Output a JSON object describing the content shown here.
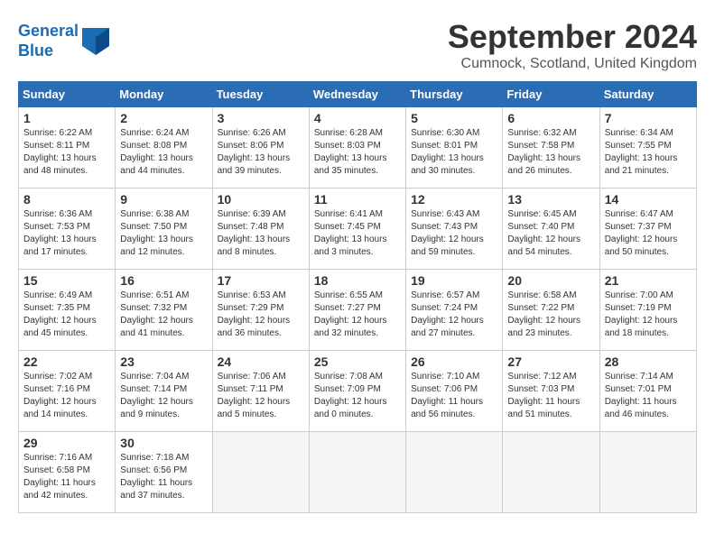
{
  "header": {
    "logo_line1": "General",
    "logo_line2": "Blue",
    "month": "September 2024",
    "location": "Cumnock, Scotland, United Kingdom"
  },
  "weekdays": [
    "Sunday",
    "Monday",
    "Tuesday",
    "Wednesday",
    "Thursday",
    "Friday",
    "Saturday"
  ],
  "weeks": [
    [
      {
        "day": 1,
        "info": "Sunrise: 6:22 AM\nSunset: 8:11 PM\nDaylight: 13 hours\nand 48 minutes."
      },
      {
        "day": 2,
        "info": "Sunrise: 6:24 AM\nSunset: 8:08 PM\nDaylight: 13 hours\nand 44 minutes."
      },
      {
        "day": 3,
        "info": "Sunrise: 6:26 AM\nSunset: 8:06 PM\nDaylight: 13 hours\nand 39 minutes."
      },
      {
        "day": 4,
        "info": "Sunrise: 6:28 AM\nSunset: 8:03 PM\nDaylight: 13 hours\nand 35 minutes."
      },
      {
        "day": 5,
        "info": "Sunrise: 6:30 AM\nSunset: 8:01 PM\nDaylight: 13 hours\nand 30 minutes."
      },
      {
        "day": 6,
        "info": "Sunrise: 6:32 AM\nSunset: 7:58 PM\nDaylight: 13 hours\nand 26 minutes."
      },
      {
        "day": 7,
        "info": "Sunrise: 6:34 AM\nSunset: 7:55 PM\nDaylight: 13 hours\nand 21 minutes."
      }
    ],
    [
      {
        "day": 8,
        "info": "Sunrise: 6:36 AM\nSunset: 7:53 PM\nDaylight: 13 hours\nand 17 minutes."
      },
      {
        "day": 9,
        "info": "Sunrise: 6:38 AM\nSunset: 7:50 PM\nDaylight: 13 hours\nand 12 minutes."
      },
      {
        "day": 10,
        "info": "Sunrise: 6:39 AM\nSunset: 7:48 PM\nDaylight: 13 hours\nand 8 minutes."
      },
      {
        "day": 11,
        "info": "Sunrise: 6:41 AM\nSunset: 7:45 PM\nDaylight: 13 hours\nand 3 minutes."
      },
      {
        "day": 12,
        "info": "Sunrise: 6:43 AM\nSunset: 7:43 PM\nDaylight: 12 hours\nand 59 minutes."
      },
      {
        "day": 13,
        "info": "Sunrise: 6:45 AM\nSunset: 7:40 PM\nDaylight: 12 hours\nand 54 minutes."
      },
      {
        "day": 14,
        "info": "Sunrise: 6:47 AM\nSunset: 7:37 PM\nDaylight: 12 hours\nand 50 minutes."
      }
    ],
    [
      {
        "day": 15,
        "info": "Sunrise: 6:49 AM\nSunset: 7:35 PM\nDaylight: 12 hours\nand 45 minutes."
      },
      {
        "day": 16,
        "info": "Sunrise: 6:51 AM\nSunset: 7:32 PM\nDaylight: 12 hours\nand 41 minutes."
      },
      {
        "day": 17,
        "info": "Sunrise: 6:53 AM\nSunset: 7:29 PM\nDaylight: 12 hours\nand 36 minutes."
      },
      {
        "day": 18,
        "info": "Sunrise: 6:55 AM\nSunset: 7:27 PM\nDaylight: 12 hours\nand 32 minutes."
      },
      {
        "day": 19,
        "info": "Sunrise: 6:57 AM\nSunset: 7:24 PM\nDaylight: 12 hours\nand 27 minutes."
      },
      {
        "day": 20,
        "info": "Sunrise: 6:58 AM\nSunset: 7:22 PM\nDaylight: 12 hours\nand 23 minutes."
      },
      {
        "day": 21,
        "info": "Sunrise: 7:00 AM\nSunset: 7:19 PM\nDaylight: 12 hours\nand 18 minutes."
      }
    ],
    [
      {
        "day": 22,
        "info": "Sunrise: 7:02 AM\nSunset: 7:16 PM\nDaylight: 12 hours\nand 14 minutes."
      },
      {
        "day": 23,
        "info": "Sunrise: 7:04 AM\nSunset: 7:14 PM\nDaylight: 12 hours\nand 9 minutes."
      },
      {
        "day": 24,
        "info": "Sunrise: 7:06 AM\nSunset: 7:11 PM\nDaylight: 12 hours\nand 5 minutes."
      },
      {
        "day": 25,
        "info": "Sunrise: 7:08 AM\nSunset: 7:09 PM\nDaylight: 12 hours\nand 0 minutes."
      },
      {
        "day": 26,
        "info": "Sunrise: 7:10 AM\nSunset: 7:06 PM\nDaylight: 11 hours\nand 56 minutes."
      },
      {
        "day": 27,
        "info": "Sunrise: 7:12 AM\nSunset: 7:03 PM\nDaylight: 11 hours\nand 51 minutes."
      },
      {
        "day": 28,
        "info": "Sunrise: 7:14 AM\nSunset: 7:01 PM\nDaylight: 11 hours\nand 46 minutes."
      }
    ],
    [
      {
        "day": 29,
        "info": "Sunrise: 7:16 AM\nSunset: 6:58 PM\nDaylight: 11 hours\nand 42 minutes."
      },
      {
        "day": 30,
        "info": "Sunrise: 7:18 AM\nSunset: 6:56 PM\nDaylight: 11 hours\nand 37 minutes."
      },
      null,
      null,
      null,
      null,
      null
    ]
  ]
}
